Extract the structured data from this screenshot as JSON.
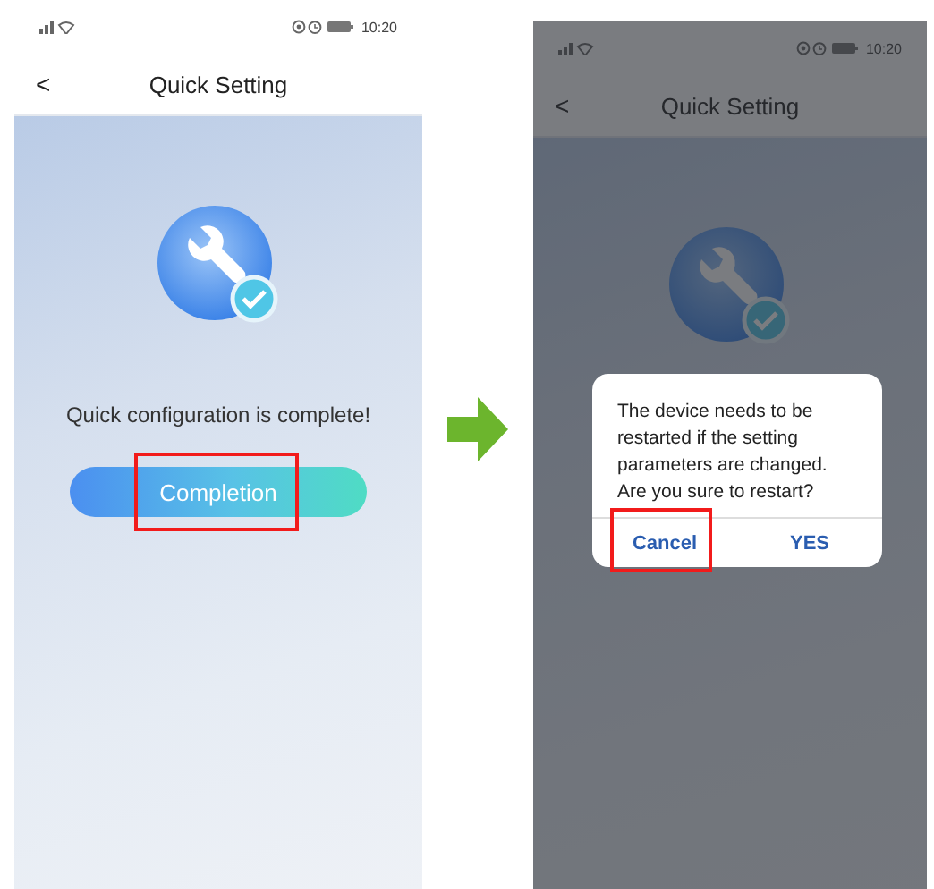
{
  "screens": [
    {
      "status_bar": {
        "time": "10:20"
      },
      "back": "<",
      "title": "Quick Setting",
      "dimmed": false,
      "message": "Quick configuration is complete!",
      "button": {
        "label": "Completion",
        "highlighted": true
      }
    },
    {
      "status_bar": {
        "time": "10:20"
      },
      "back": "<",
      "title": "Quick Setting",
      "dimmed": true,
      "dialog": {
        "message": "The device needs to be restarted if the setting parameters are changed. Are you sure to restart?",
        "buttons": [
          {
            "label": "Cancel",
            "highlighted": true
          },
          {
            "label": "YES",
            "highlighted": false
          }
        ]
      }
    }
  ]
}
